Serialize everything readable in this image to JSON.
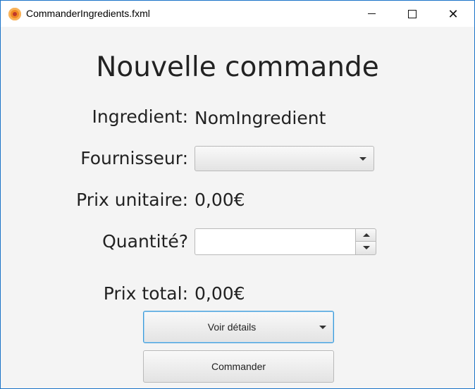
{
  "window": {
    "title": "CommanderIngredients.fxml",
    "icon": "javafx-app-icon",
    "controls": [
      "minimize-icon",
      "maximize-icon",
      "close-icon"
    ]
  },
  "form": {
    "heading": "Nouvelle commande",
    "ingredient_label": "Ingredient:",
    "ingredient_value": "NomIngredient",
    "supplier_label": "Fournisseur:",
    "supplier_selected": "",
    "unit_price_label": "Prix unitaire:",
    "unit_price_value": "0,00€",
    "quantity_label": "Quantité?",
    "quantity_value": "",
    "total_label": "Prix total:",
    "total_value": "0,00€",
    "details_button": "Voir détails",
    "order_button": "Commander"
  }
}
